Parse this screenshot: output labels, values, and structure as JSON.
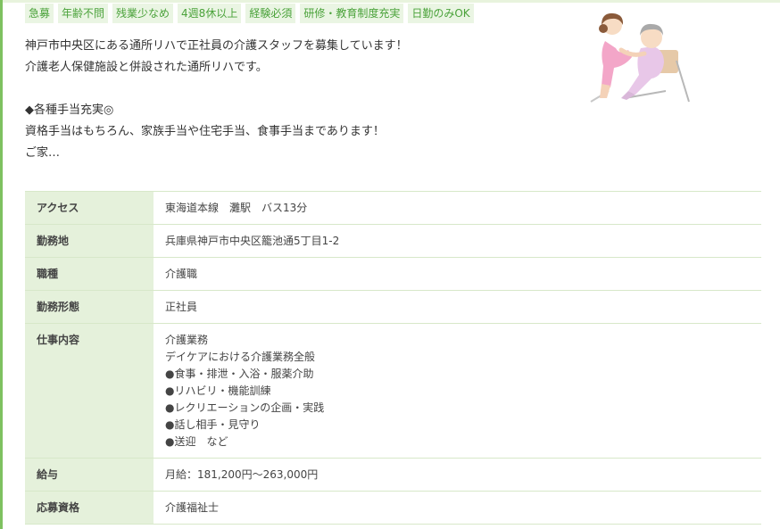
{
  "tags": [
    "急募",
    "年齢不問",
    "残業少なめ",
    "4週8休以上",
    "経験必須",
    "研修・教育制度充実",
    "日勤のみOK"
  ],
  "intro": {
    "line1": "神戸市中央区にある通所リハで正社員の介護スタッフを募集しています！",
    "line2": "介護老人保健施設と併設された通所リハです。",
    "line3": "◆各種手当充実◎",
    "line4": "資格手当はもちろん、家族手当や住宅手当、食事手当まであります！",
    "line5": "ご家…"
  },
  "table": {
    "access": {
      "label": "アクセス",
      "value": "東海道本線　灘駅　バス13分"
    },
    "location": {
      "label": "勤務地",
      "value": "兵庫県神戸市中央区籠池通5丁目1-2"
    },
    "job_type": {
      "label": "職種",
      "value": "介護職"
    },
    "employment": {
      "label": "勤務形態",
      "value": "正社員"
    },
    "duties": {
      "label": "仕事内容",
      "lines": [
        "介護業務",
        "デイケアにおける介護業務全般",
        "●食事・排泄・入浴・服薬介助",
        "●リハビリ・機能訓練",
        "●レクリエーションの企画・実践",
        "●話し相手・見守り",
        "●送迎　など"
      ]
    },
    "salary": {
      "label": "給与",
      "value": "月給：181,200円〜263,000円"
    },
    "qualification": {
      "label": "応募資格",
      "value": "介護福祉士"
    }
  },
  "colors": {
    "accent": "#7ec160",
    "tag_bg": "#eaf5e3",
    "tag_text": "#4aa23a",
    "header_bg": "#e5f1db",
    "border": "#d7e8c9"
  },
  "icons": {
    "illustration": "caregiver-with-elderly-person-illustration"
  }
}
